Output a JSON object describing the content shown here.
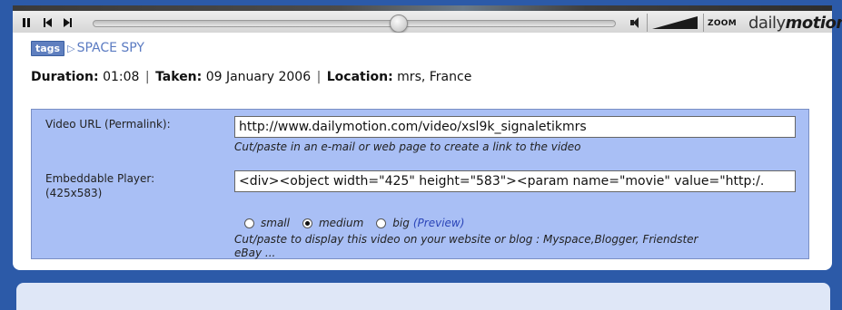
{
  "player": {
    "seek_position": 0.583,
    "zoom_label": "ZOOM",
    "logo_text_left": "daily",
    "logo_text_right": "motion"
  },
  "tags": {
    "badge": "tags",
    "items": [
      "SPACE SPY"
    ]
  },
  "meta": {
    "duration_label": "Duration:",
    "duration_value": "01:08",
    "taken_label": "Taken:",
    "taken_value": "09 January 2006",
    "location_label": "Location:",
    "location_value": "mrs, France"
  },
  "share": {
    "url_label": "Video URL (Permalink):",
    "url_value": "http://www.dailymotion.com/video/xsl9k_signaletikmrs",
    "url_hint": "Cut/paste in an e-mail or web page to create a link to the video",
    "embed_label": "Embeddable Player:",
    "embed_size": "(425x583)",
    "embed_value": "<div><object width=\"425\" height=\"583\"><param name=\"movie\" value=\"http:/.",
    "sizes": [
      {
        "label": "small",
        "checked": false
      },
      {
        "label": "medium",
        "checked": true
      },
      {
        "label": "big",
        "checked": false
      }
    ],
    "preview_label": "(Preview)",
    "embed_hint_line1": "Cut/paste to display this video on your website or blog : Myspace,Blogger, Friendster",
    "embed_hint_line2": "eBay ..."
  },
  "colors": {
    "page_background": "#2c5aa8",
    "share_box": "#a9bff5",
    "link": "#5b7bc2"
  }
}
